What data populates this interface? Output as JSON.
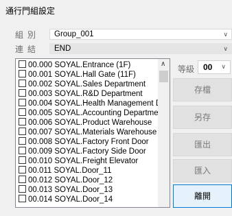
{
  "window": {
    "title": "通行門組設定"
  },
  "group": {
    "label": "組別",
    "value": "Group_001"
  },
  "link": {
    "label": "連結",
    "value": "END"
  },
  "doors": [
    "00.000 SOYAL.Entrance (1F)",
    "00.001 SOYAL.Hall Gate (11F)",
    "00.002 SOYAL.Sales Department",
    "00.003 SOYAL.R&D Department",
    "00.004 SOYAL.Health Management D",
    "00.005 SOYAL.Accounting Departmer",
    "00.006 SOYAL.Product Warehouse",
    "00.007 SOYAL.Materials Warehouse",
    "00.008 SOYAL.Factory Front Door",
    "00.009 SOYAL.Factory Side Door",
    "00.010 SOYAL.Freight Elevator",
    "00.011 SOYAL.Door_11",
    "00.012 SOYAL.Door_12",
    "00.013 SOYAL.Door_13",
    "00.014 SOYAL.Door_14"
  ],
  "level": {
    "label": "等級",
    "value": "00"
  },
  "buttons": {
    "save": "存檔",
    "save_as": "另存",
    "export": "匯出",
    "import": "匯入",
    "exit": "離開"
  }
}
